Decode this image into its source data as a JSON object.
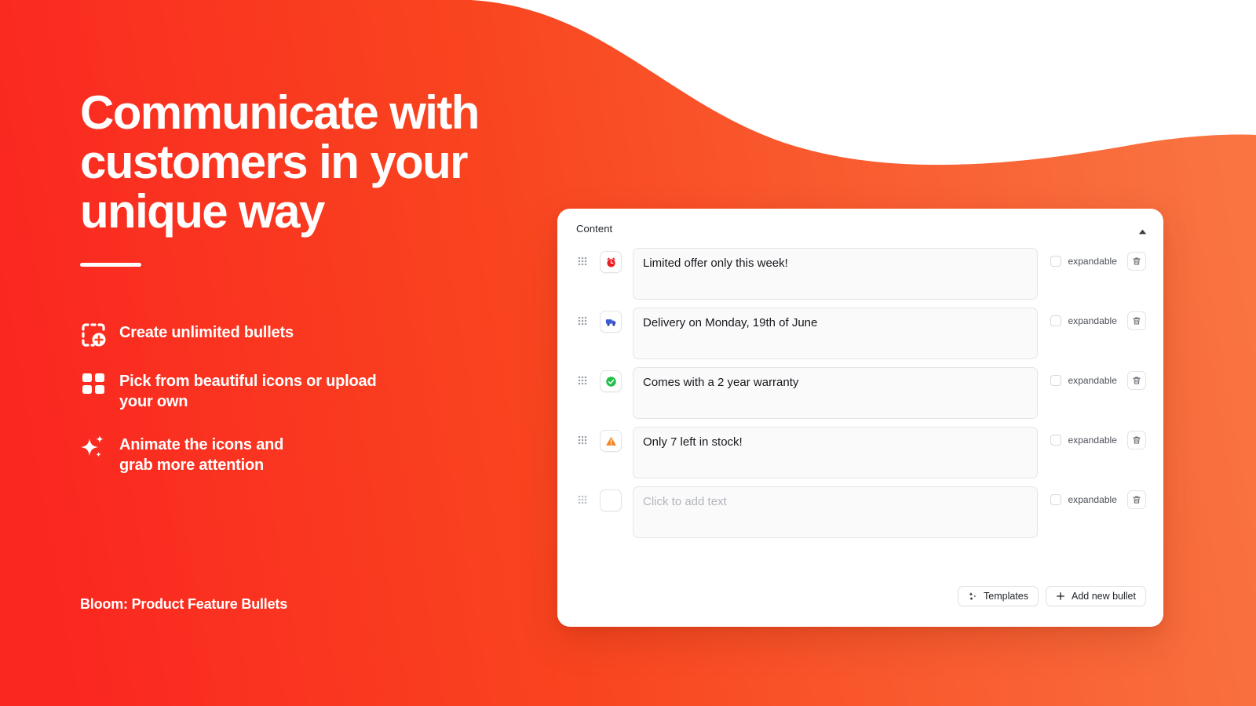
{
  "theme": {
    "gradient_start": "#FA2620",
    "gradient_end": "#F96D40",
    "page_bg": "#FFFFFF",
    "card_bg": "#FFFFFF",
    "field_bg": "#FAFAFA"
  },
  "hero": {
    "title": "Communicate with\ncustomers in your\nunique way",
    "features": [
      {
        "icon": "add-bullet-icon",
        "label": "Create unlimited bullets"
      },
      {
        "icon": "grid-icons-icon",
        "label": "Pick from beautiful icons or upload\nyour own"
      },
      {
        "icon": "sparkles-icon",
        "label": "Animate the icons and\ngrab more attention"
      }
    ]
  },
  "brand": {
    "text": "Bloom: Product Feature Bullets"
  },
  "card": {
    "title": "Content",
    "collapse_icon": "caret-up-icon",
    "expandable_label": "expandable",
    "delete_icon": "trash-icon",
    "drag_icon": "drag-handle-icon",
    "rows": [
      {
        "icon": "alarm-clock-icon",
        "icon_glyph": "⏰",
        "text": "Limited offer only this week!",
        "placeholder": "Click to add text",
        "expandable": false,
        "has_icon": true
      },
      {
        "icon": "delivery-truck-icon",
        "icon_glyph": "🚚",
        "text": "Delivery on Monday, 19th of June",
        "placeholder": "Click to add text",
        "expandable": false,
        "has_icon": true
      },
      {
        "icon": "check-circle-icon",
        "icon_glyph": "✅",
        "text": "Comes with a 2 year warranty",
        "placeholder": "Click to add text",
        "expandable": false,
        "has_icon": true
      },
      {
        "icon": "warning-triangle-icon",
        "icon_glyph": "⚠️",
        "text": "Only 7 left in stock!",
        "placeholder": "Click to add text",
        "expandable": false,
        "has_icon": true
      },
      {
        "icon": "empty-icon-slot",
        "icon_glyph": "",
        "text": "",
        "placeholder": "Click to add text",
        "expandable": false,
        "has_icon": false
      }
    ],
    "actions": {
      "templates_label": "Templates",
      "templates_icon": "sparkle-wand-icon",
      "add_bullet_label": "Add new bullet",
      "add_bullet_icon": "plus-icon"
    }
  }
}
